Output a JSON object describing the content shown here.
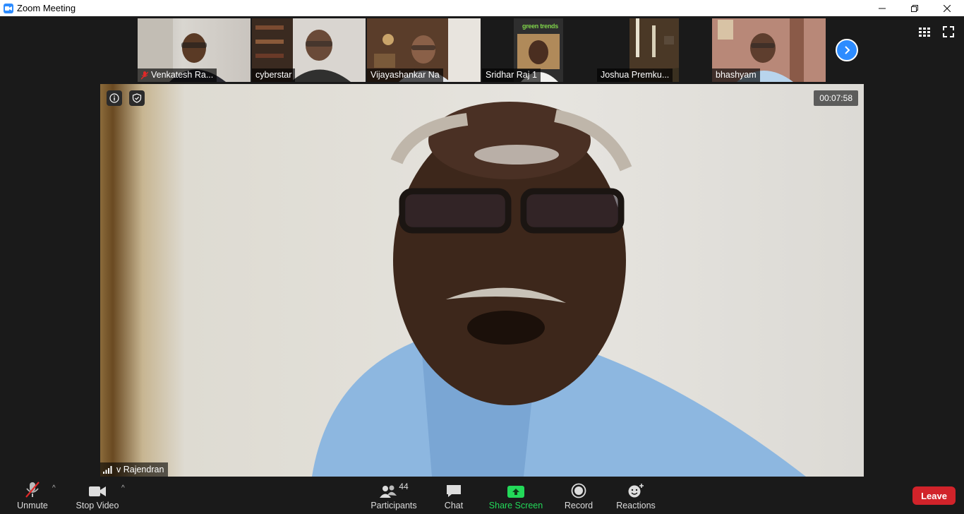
{
  "window": {
    "title": "Zoom Meeting"
  },
  "thumbnails": [
    {
      "name": "Venkatesh Ra...",
      "muted": true
    },
    {
      "name": "cyberstar",
      "muted": false
    },
    {
      "name": "Vijayashankar Na",
      "muted": false
    },
    {
      "name": "Sridhar Raj 1",
      "muted": false
    },
    {
      "name": "Joshua Premku...",
      "muted": false
    },
    {
      "name": "bhashyam",
      "muted": false
    }
  ],
  "thumb_sign": "green trends",
  "main": {
    "speaker": "v Rajendran",
    "timer": "00:07:58"
  },
  "toolbar": {
    "unmute": "Unmute",
    "stop_video": "Stop Video",
    "participants": "Participants",
    "participants_count": "44",
    "chat": "Chat",
    "share_screen": "Share Screen",
    "record": "Record",
    "reactions": "Reactions",
    "leave": "Leave"
  },
  "colors": {
    "accent": "#2d8cff",
    "share": "#23d959",
    "leave": "#d1232a",
    "mute": "#e02828"
  }
}
